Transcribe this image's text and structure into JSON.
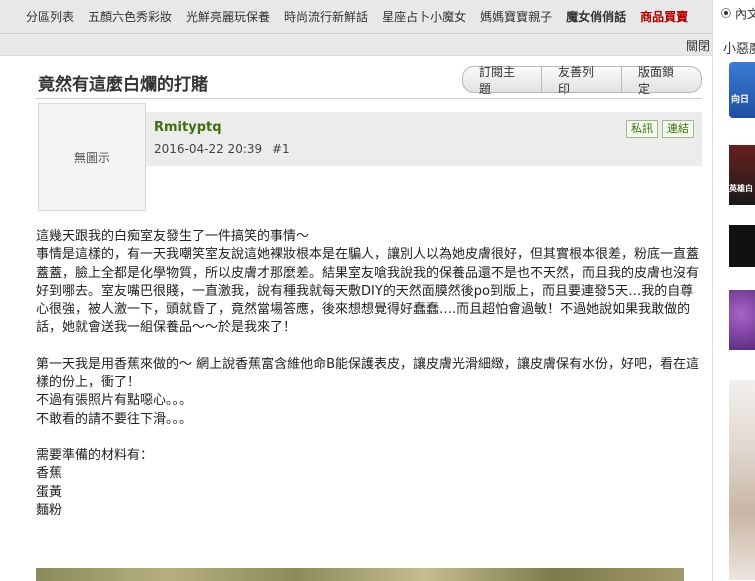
{
  "topnav": {
    "items": [
      {
        "label": "分區列表",
        "style": "normal"
      },
      {
        "label": "五顏六色秀彩妝",
        "style": "normal"
      },
      {
        "label": "光鮮亮麗玩保養",
        "style": "normal"
      },
      {
        "label": "時尚流行新鮮話",
        "style": "normal"
      },
      {
        "label": "星座占卜小魔女",
        "style": "normal"
      },
      {
        "label": "媽媽寶寶親子",
        "style": "normal"
      },
      {
        "label": "魔女俏俏話",
        "style": "bold"
      },
      {
        "label": "商品買賣",
        "style": "red"
      }
    ],
    "close_label": "關閉"
  },
  "post": {
    "title": "竟然有這麼白爛的打賭",
    "buttons": {
      "subscribe": "訂閱主題",
      "print": "友善列印",
      "lock": "版面鎖定"
    },
    "avatar_text": "無圖示",
    "author": "Rmityptq",
    "date": "2016-04-22 20:39",
    "floor": "#1",
    "actions": {
      "message": "私訊",
      "link": "連結"
    },
    "paragraphs": [
      "這幾天跟我的白痴室友發生了一件搞笑的事情～",
      "事情是這樣的，有一天我嘲笑室友說這她裸妝根本是在騙人，讓別人以為她皮膚很好，但其實根本很差，粉底一直蓋蓋蓋，臉上全都是化學物質，所以皮膚才那麼差。結果室友嗆我說我的保養品還不是也不天然，而且我的皮膚也沒有好到哪去。室友嘴巴很賤，一直激我，說有種我就每天敷DIY的天然面膜然後po到版上，而且要連發5天…我的自尊心很強，被人激一下，頭就昏了，竟然當場答應，後來想想覺得好蠢蠢….而且超怕會過敏！不過她說如果我敢做的話，她就會送我一組保養品～～於是我來了！",
      "",
      "第一天我是用香蕉來做的～ 網上說香蕉富含維他命B能保護表皮，讓皮膚光滑細緻，讓皮膚保有水份，好吧，看在這樣的份上，衝了！",
      "不過有張照片有點噁心。。。",
      "不敢看的請不要往下滑。。。",
      "",
      "需要準備的材料有：",
      "香蕉",
      "蛋黃",
      "麵粉"
    ]
  },
  "sidebar": {
    "radio_label": "內文",
    "header": "小惡魔",
    "ad1_label": "向日",
    "ad2_label": "英雄白"
  }
}
